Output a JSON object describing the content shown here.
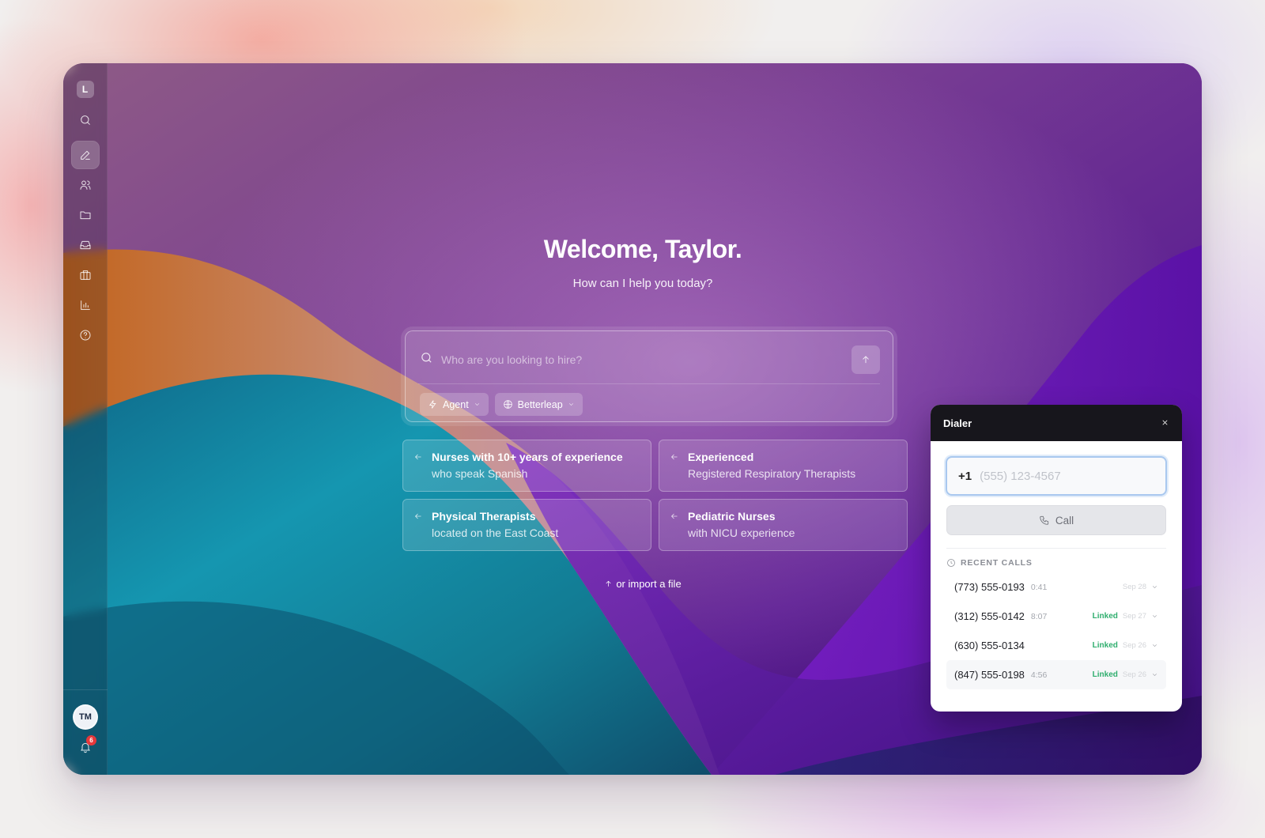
{
  "app": {
    "logo_letter": "L"
  },
  "sidebar": {
    "items": [
      {
        "name": "search",
        "icon": "search-icon",
        "active": false
      },
      {
        "name": "compose",
        "icon": "pencil-icon",
        "active": true
      },
      {
        "name": "people",
        "icon": "users-icon",
        "active": false
      },
      {
        "name": "projects",
        "icon": "folder-icon",
        "active": false
      },
      {
        "name": "inbox",
        "icon": "inbox-icon",
        "active": false
      },
      {
        "name": "jobs",
        "icon": "briefcase-icon",
        "active": false
      },
      {
        "name": "analytics",
        "icon": "bar-chart-icon",
        "active": false
      },
      {
        "name": "help",
        "icon": "help-circle-icon",
        "active": false
      }
    ],
    "user_initials": "TM",
    "notification_count": "6"
  },
  "hero": {
    "title": "Welcome, Taylor.",
    "subtitle": "How can I help you today?"
  },
  "search": {
    "placeholder": "Who are you looking to hire?",
    "value": "",
    "chips": [
      {
        "label": "Agent",
        "icon": "lightning-icon"
      },
      {
        "label": "Betterleap",
        "icon": "globe-icon"
      }
    ]
  },
  "suggestions": [
    {
      "title": "Nurses with 10+ years of experience",
      "subtitle": "who speak Spanish"
    },
    {
      "title": "Experienced",
      "subtitle": "Registered Respiratory Therapists"
    },
    {
      "title": "Physical Therapists",
      "subtitle": "located on the East Coast"
    },
    {
      "title": "Pediatric Nurses",
      "subtitle": "with NICU experience"
    }
  ],
  "import_label": "or import a file",
  "dialer": {
    "title": "Dialer",
    "country_code": "+1",
    "phone_placeholder": "(555) 123-4567",
    "phone_value": "",
    "call_label": "Call",
    "recent_label": "RECENT CALLS",
    "recent_calls": [
      {
        "number": "(773) 555-0193",
        "duration": "0:41",
        "linked": "",
        "date": "Sep 28"
      },
      {
        "number": "(312) 555-0142",
        "duration": "8:07",
        "linked": "Linked",
        "date": "Sep 27"
      },
      {
        "number": "(630) 555-0134",
        "duration": "",
        "linked": "Linked",
        "date": "Sep 26"
      },
      {
        "number": "(847) 555-0198",
        "duration": "4:56",
        "linked": "Linked",
        "date": "Sep 26"
      }
    ]
  },
  "colors": {
    "accent_linked": "#2fae6e",
    "badge": "#e5383b",
    "dialer_header": "#17161c"
  }
}
